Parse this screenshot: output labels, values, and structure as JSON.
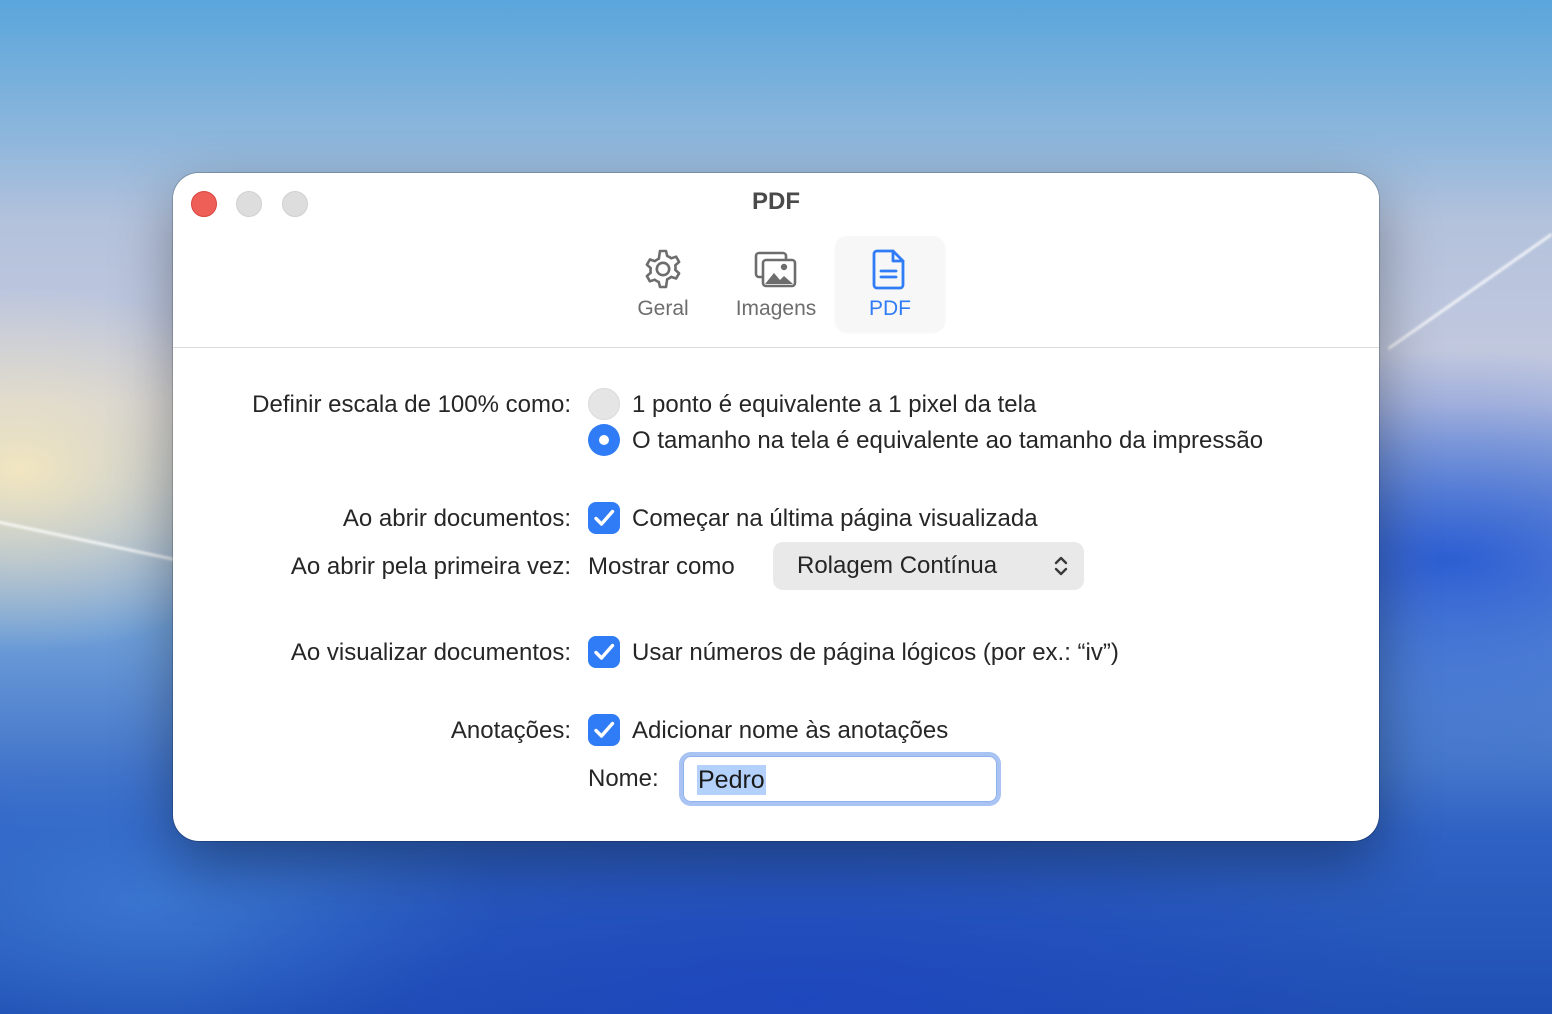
{
  "window": {
    "title": "PDF"
  },
  "toolbar": {
    "tabs": [
      {
        "label": "Geral",
        "icon": "gear-icon",
        "selected": false
      },
      {
        "label": "Imagens",
        "icon": "photos-icon",
        "selected": false
      },
      {
        "label": "PDF",
        "icon": "document-icon",
        "selected": true
      }
    ]
  },
  "settings": {
    "scale": {
      "label": "Definir escala de 100% como:",
      "options": [
        {
          "label": "1 ponto é equivalente a 1 pixel da tela",
          "selected": false
        },
        {
          "label": "O tamanho na tela é equivalente ao tamanho da impressão",
          "selected": true
        }
      ]
    },
    "opening": {
      "label": "Ao abrir documentos:",
      "checkbox_label": "Começar na última página visualizada",
      "checked": true
    },
    "first_open": {
      "label": "Ao abrir pela primeira vez:",
      "show_as_label": "Mostrar como",
      "popup_value": "Rolagem Contínua"
    },
    "viewing": {
      "label": "Ao visualizar documentos:",
      "checkbox_label": "Usar números de página lógicos (por ex.: “iv”)",
      "checked": true
    },
    "annotations": {
      "label": "Anotações:",
      "checkbox_label": "Adicionar nome às anotações",
      "checked": true,
      "name_label": "Nome:",
      "name_value": "Pedro"
    }
  },
  "colors": {
    "accent": "#2f7cf6",
    "close_button": "#ee5f58"
  }
}
